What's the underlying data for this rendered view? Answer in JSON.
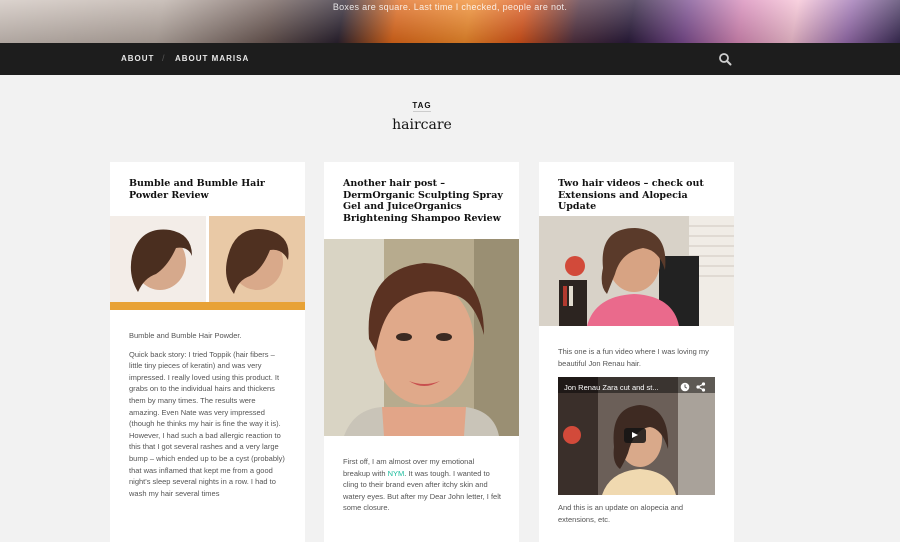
{
  "site": {
    "tagline": "Boxes are square. Last time I checked, people are not."
  },
  "nav": {
    "items": [
      {
        "label": "ABOUT"
      },
      {
        "label": "ABOUT MARISA"
      }
    ],
    "separator": "/",
    "search_icon": "search-icon"
  },
  "archive": {
    "label": "TAG",
    "title": "haircare"
  },
  "posts": [
    {
      "title": "Bumble and Bumble Hair Powder Review",
      "image_caption": "bumble and bumble hair powder before and after",
      "paragraphs": [
        "Bumble and Bumble Hair Powder.",
        "Quick back story: I tried Toppik (hair fibers – little tiny pieces of keratin) and was very impressed. I really loved using this product. It grabs on to the individual hairs and thickens them by many times. The results were amazing. Even Nate was very impressed (though he thinks my hair is fine the way it is). However, I had such a bad allergic reaction to this that I got several rashes and a very large bump – which ended up to be a cyst (probably) that was inflamed that kept me from a good night's sleep several nights in a row. I had to wash my hair several times"
      ]
    },
    {
      "title": "Another hair post – DermOrganic Sculpting Spray Gel and JuiceOrganics Brightening Shampoo Review",
      "text_before_link": "First off, I am almost over my emotional breakup with ",
      "link_text": "NYM",
      "text_after_link": ". It was tough. I wanted to cling to their brand even after itchy skin and watery eyes. But after my Dear John letter, I felt some closure."
    },
    {
      "title": "Two hair videos – check out Extensions and Alopecia Update",
      "paragraphs": [
        "This one is a fun video where I was loving my beautiful Jon Renau hair.",
        "And this is an update on alopecia and extensions, etc."
      ],
      "video_title": "Jon Renau Zara cut and st..."
    }
  ]
}
